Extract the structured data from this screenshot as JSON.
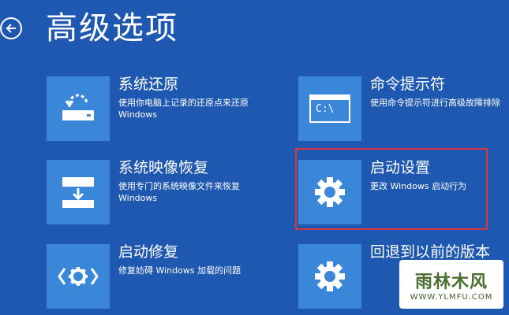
{
  "header": {
    "title": "高级选项",
    "back_icon": "back-arrow-icon"
  },
  "options": {
    "system_restore": {
      "title": "系统还原",
      "desc_line1": "使用你电脑上记录的还原点来还原",
      "desc_line2": "Windows",
      "icon": "restore-drive-icon"
    },
    "system_image_recovery": {
      "title": "系统映像恢复",
      "desc_line1": "使用专门的系统映像文件来恢复",
      "desc_line2": "Windows",
      "icon": "image-recovery-icon"
    },
    "startup_repair": {
      "title": "启动修复",
      "desc_line1": "修复妨碍 Windows 加载的问题",
      "icon": "repair-gear-icon"
    },
    "command_prompt": {
      "title": "命令提示符",
      "desc_line1": "使用命令提示符进行高级故障排除",
      "icon_text": "C:\\",
      "icon": "command-prompt-icon"
    },
    "startup_settings": {
      "title": "启动设置",
      "desc_line1": "更改 Windows 启动行为",
      "icon": "gear-icon",
      "highlighted": true
    },
    "go_back": {
      "title": "回退到以前的版本",
      "icon": "gear-icon"
    }
  },
  "watermark": {
    "main": "雨林木风",
    "url": "WWW.YLMFU.COM"
  },
  "colors": {
    "background": "#1e58b0",
    "tile": "#3a86d8",
    "highlight": "#d9383f"
  }
}
